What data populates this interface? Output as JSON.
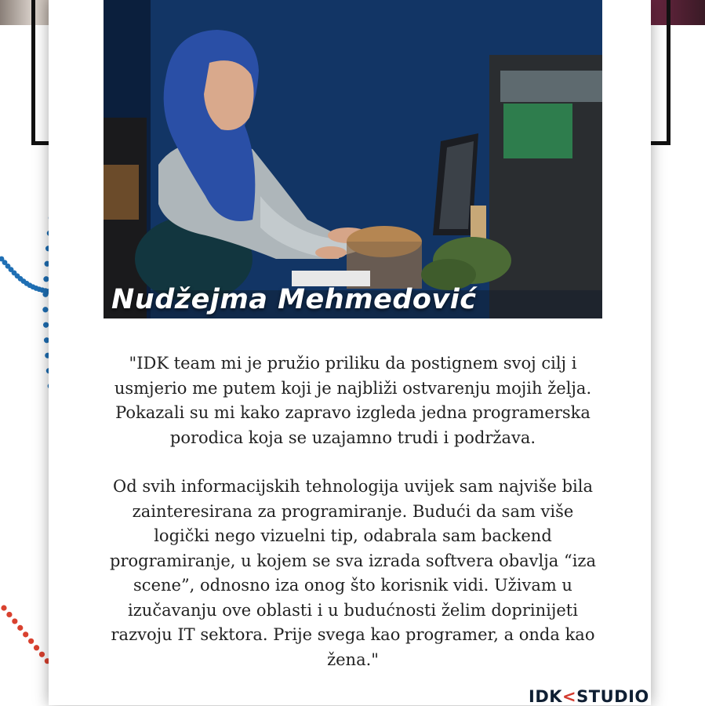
{
  "profile": {
    "name": "Nudžejma Mehmedović"
  },
  "quote": {
    "paragraph_1": "\"IDK team mi je pružio priliku da postignem svoj cilj i usmjerio me putem koji je najbliži ostvarenju mojih želja. Pokazali su mi kako zapravo izgleda jedna programerska porodica koja se uzajamno trudi i podržava.",
    "paragraph_2": "Od svih informacijskih tehnologija uvijek sam najviše bila zainteresirana za programiranje. Budući da sam više logički nego vizuelni tip, odabrala sam backend programiranje, u kojem se sva izrada softvera obavlja “iza scene”, odnosno iza onog što korisnik vidi. Uživam u izučavanju ove oblasti i u budućnosti želim doprinijeti razvoju IT sektora. Prije svega kao programer, a onda kao žena.\""
  },
  "brand": {
    "logo_left": "IDK",
    "logo_mark": "<",
    "logo_right": "STUDIO"
  },
  "colors": {
    "dot_blue": "#1f6fb4",
    "dot_red": "#d9412f",
    "hijab_blue": "#2a4fa6",
    "logo_red": "#d33a2e"
  },
  "icons": {
    "photo": "woman-at-laptop-photo"
  }
}
